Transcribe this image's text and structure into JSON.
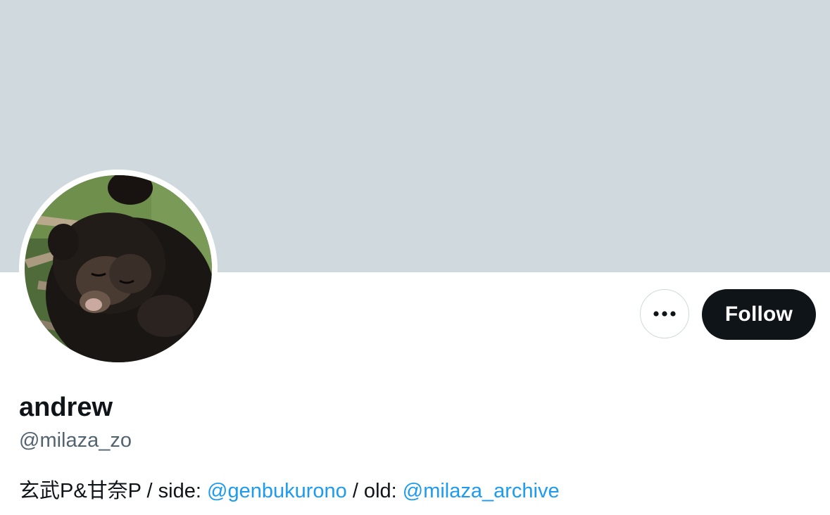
{
  "profile": {
    "display_name": "andrew",
    "handle": "@milaza_zo",
    "bio": {
      "prefix": "玄武P&甘奈P / side: ",
      "mention_side": "@genbukurono",
      "middle": " / old: ",
      "mention_old": "@milaza_archive"
    }
  },
  "actions": {
    "more_icon": "ellipsis-icon",
    "follow_label": "Follow"
  },
  "colors": {
    "banner": "#cfd9de",
    "follow_bg": "#0f1419",
    "mention": "#1d9bf0",
    "handle": "#536471"
  },
  "avatar": {
    "description_icon": "bear-cub-avatar"
  }
}
